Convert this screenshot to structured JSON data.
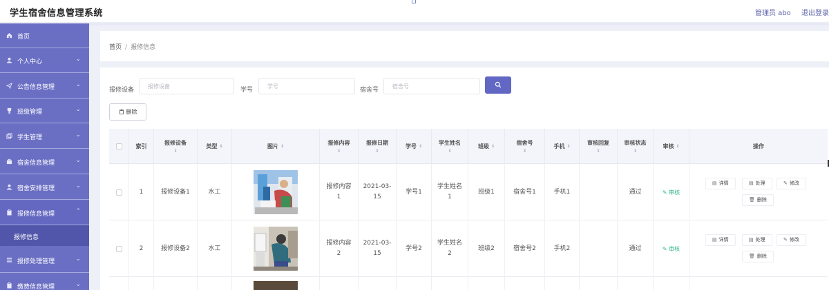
{
  "app": {
    "title": "学生宿舍信息管理系统"
  },
  "header": {
    "user_label": "管理员 abo",
    "logout_label": "退出登录"
  },
  "sidebar": {
    "items": [
      {
        "label": "首页",
        "icon": "home-icon",
        "has_children": false
      },
      {
        "label": "个人中心",
        "icon": "user-icon",
        "has_children": true
      },
      {
        "label": "公告信息管理",
        "icon": "send-icon",
        "has_children": true
      },
      {
        "label": "班级管理",
        "icon": "trophy-icon",
        "has_children": true
      },
      {
        "label": "学生管理",
        "icon": "copy-icon",
        "has_children": true
      },
      {
        "label": "宿舍信息管理",
        "icon": "briefcase-icon",
        "has_children": true
      },
      {
        "label": "宿舍安排管理",
        "icon": "user-icon",
        "has_children": true
      },
      {
        "label": "报修信息管理",
        "icon": "clipboard-icon",
        "has_children": true,
        "expanded": true
      },
      {
        "label": "报修处理管理",
        "icon": "list-icon",
        "has_children": true
      },
      {
        "label": "缴费信息管理",
        "icon": "clipboard-icon",
        "has_children": true
      }
    ],
    "active_sub": {
      "label": "报修信息"
    }
  },
  "breadcrumb": {
    "home": "首页",
    "separator": "/",
    "current": "报修信息"
  },
  "filters": {
    "device": {
      "label": "报修设备",
      "placeholder": "报修设备",
      "value": ""
    },
    "student_no": {
      "label": "学号",
      "placeholder": "学号",
      "value": ""
    },
    "dorm_no": {
      "label": "宿舍号",
      "placeholder": "宿舍号",
      "value": ""
    },
    "search_icon": "search-icon"
  },
  "toolbar": {
    "delete_label": "删除",
    "delete_icon": "trash-icon"
  },
  "table": {
    "headers": {
      "index": "索引",
      "device": "报修设备",
      "type": "类型",
      "image": "图片",
      "content": "报修内容",
      "date": "报修日期",
      "student_no": "学号",
      "student_name": "学生姓名",
      "class": "班级",
      "dorm_no": "宿舍号",
      "phone": "手机",
      "reply": "审核回复",
      "status": "审核状态",
      "audit": "审核",
      "actions": "操作"
    },
    "rows": [
      {
        "index": "1",
        "device": "报修设备1",
        "type": "水工",
        "content_line1": "报修内容",
        "content_line2": "1",
        "date_line1": "2021-03-",
        "date_line2": "15",
        "student_no": "学号1",
        "name_line1": "学生姓名",
        "name_line2": "1",
        "class": "班级1",
        "dorm_no": "宿舍号1",
        "phone": "手机1",
        "reply": "",
        "status": "通过",
        "audit_label": "审核"
      },
      {
        "index": "2",
        "device": "报修设备2",
        "type": "水工",
        "content_line1": "报修内容",
        "content_line2": "2",
        "date_line1": "2021-03-",
        "date_line2": "15",
        "student_no": "学号2",
        "name_line1": "学生姓名",
        "name_line2": "2",
        "class": "班级2",
        "dorm_no": "宿舍号2",
        "phone": "手机2",
        "reply": "",
        "status": "通过",
        "audit_label": "审核"
      }
    ],
    "action_labels": {
      "detail": "详情",
      "process": "处理",
      "edit": "修改",
      "delete": "删除"
    }
  },
  "colors": {
    "sidebar_bg": "#6b6fc4",
    "sidebar_active_sub": "#5256aa",
    "primary_button": "#6167c3",
    "audit_link": "#2fb58a",
    "content_bg": "#eef0f8"
  }
}
